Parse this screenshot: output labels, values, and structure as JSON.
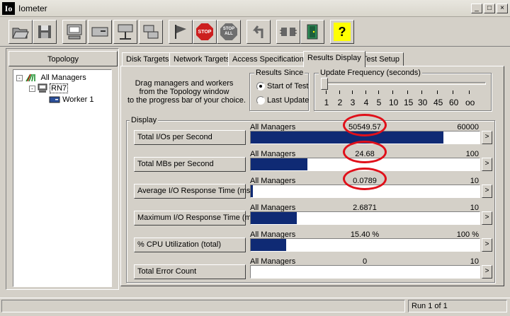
{
  "window": {
    "app_icon_text": "Io",
    "title": "Iometer",
    "minimize": "_",
    "maximize": "□",
    "close": "×"
  },
  "toolbar": {
    "buttons": [
      {
        "name": "open-config-button",
        "icon": "folder-open-icon"
      },
      {
        "name": "save-config-button",
        "icon": "floppy-disk-icon"
      },
      {
        "name": "new-disk-worker-button",
        "icon": "computer-icon"
      },
      {
        "name": "new-network-worker-button",
        "icon": "disk-drive-icon"
      },
      {
        "name": "new-manager-button",
        "icon": "network-computer-icon"
      },
      {
        "name": "duplicate-worker-button",
        "icon": "duplicate-icon"
      },
      {
        "name": "start-tests-button",
        "icon": "green-flag-icon"
      },
      {
        "name": "stop-button",
        "icon": "stop-icon",
        "label": "STOP"
      },
      {
        "name": "stop-all-button",
        "icon": "stop-all-icon",
        "label": "STOP ALL"
      },
      {
        "name": "reset-workers-button",
        "icon": "back-arrow-icon"
      },
      {
        "name": "disconnect-button",
        "icon": "disconnect-icon"
      },
      {
        "name": "exit-button",
        "icon": "exit-door-icon"
      },
      {
        "name": "about-button",
        "icon": "help-icon",
        "label": "?"
      }
    ]
  },
  "topology": {
    "header": "Topology",
    "items": [
      {
        "label": "All Managers",
        "icon": "all-managers-icon",
        "expander": "-"
      },
      {
        "label": "RN7",
        "icon": "computer-icon",
        "expander": "-"
      },
      {
        "label": "Worker 1",
        "icon": "disk-worker-icon"
      }
    ]
  },
  "tabs": [
    {
      "label": "Disk Targets",
      "active": false
    },
    {
      "label": "Network Targets",
      "active": false
    },
    {
      "label": "Access Specifications",
      "active": false
    },
    {
      "label": "Results Display",
      "active": true
    },
    {
      "label": "Test Setup",
      "active": false
    }
  ],
  "results": {
    "instructions": [
      "Drag managers and workers",
      "from the Topology window",
      "to the progress bar of your choice."
    ],
    "results_since": {
      "label": "Results Since",
      "options": [
        "Start of Test",
        "Last Update"
      ],
      "selected": 0
    },
    "update_frequency": {
      "label": "Update Frequency (seconds)",
      "ticks": [
        "1",
        "2",
        "3",
        "4",
        "5",
        "10",
        "15",
        "30",
        "45",
        "60",
        "oo"
      ],
      "selected_index": 0
    },
    "display_label": "Display",
    "metrics": [
      {
        "button": "Total I/Os per Second",
        "source": "All Managers",
        "value": "50549.57",
        "max": "60000",
        "fill": 0.8425,
        "circled": true
      },
      {
        "button": "Total MBs per Second",
        "source": "All Managers",
        "value": "24.68",
        "max": "100",
        "fill": 0.2468,
        "circled": true
      },
      {
        "button": "Average I/O Response Time (ms)",
        "source": "All Managers",
        "value": "0.0789",
        "max": "10",
        "fill": 0.0079,
        "circled": true
      },
      {
        "button": "Maximum I/O Response Time (ms)",
        "source": "All Managers",
        "value": "2.6871",
        "max": "10",
        "fill": 0.2,
        "circled": false
      },
      {
        "button": "% CPU Utilization (total)",
        "source": "All Managers",
        "value": "15.40 %",
        "max": "100 %",
        "fill": 0.154,
        "circled": false
      },
      {
        "button": "Total Error Count",
        "source": "All Managers",
        "value": "0",
        "max": "10",
        "fill": 0,
        "circled": false
      }
    ],
    "arrow_label": ">"
  },
  "status": {
    "run": "Run 1 of 1"
  },
  "colors": {
    "bar": "#0f2a74",
    "annotation": "#e0101a",
    "face": "#d4d0c8"
  }
}
